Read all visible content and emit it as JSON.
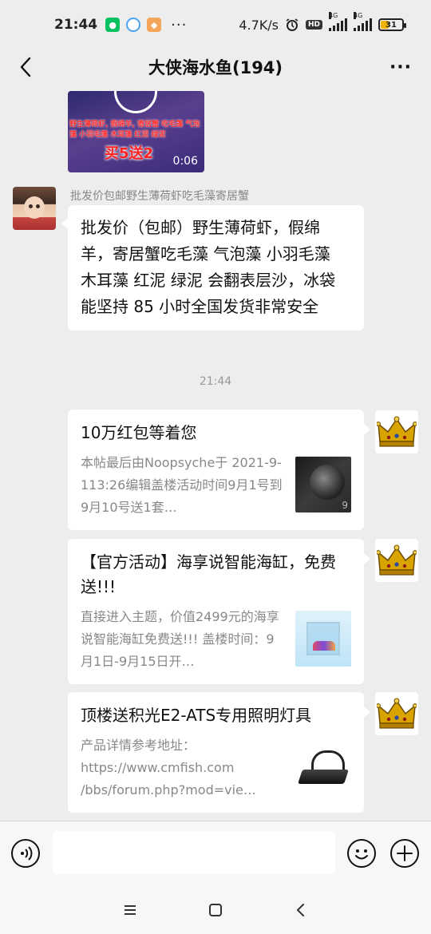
{
  "status_bar": {
    "time": "21:44",
    "speed": "4.7K/s",
    "hd": "HD",
    "net1": "4G",
    "net2": "4G",
    "battery": "31",
    "more": "···"
  },
  "header": {
    "title": "大侠海水鱼(194)",
    "more": "···"
  },
  "video": {
    "caption": "野生薄荷虾, 假绵羊, 寄居蟹 吃毛藻 气泡藻 小羽毛藻 木耳藻 红泥 绿泥",
    "promo": "买5送2",
    "duration": "0:06"
  },
  "message": {
    "sender": "批发价包邮野生薄荷虾吃毛藻寄居蟹",
    "text": "批发价（包邮）野生薄荷虾，假绵羊，寄居蟹吃毛藻 气泡藻 小羽毛藻 木耳藻 红泥 绿泥 会翻表层沙，冰袋能坚持 85 小时全国发货非常安全"
  },
  "time_separator": "21:44",
  "cards": [
    {
      "title": "10万红包等着您",
      "desc": "本帖最后由Noopsyche于 2021-9-113:26编辑盖楼活动时间9月1号到9月10号送1套…",
      "thumb_mark": "9"
    },
    {
      "title": "【官方活动】海享说智能海缸，免费送!!!",
      "desc": "直接进入主题，价值2499元的海享说智能海缸免费送!!! 盖楼时间：9月1日-9月15日开…"
    },
    {
      "title": "顶楼送积光E2-ATS专用照明灯具",
      "desc": "产品详情参考地址： https://www.cmfish.com /bbs/forum.php?mod=vie…"
    }
  ],
  "input": {
    "placeholder": ""
  },
  "colors": {
    "background": "#ededed",
    "bubble": "#ffffff",
    "crown_gold": "#d9a400",
    "wechat_green": "#07c160"
  },
  "icons": {
    "back": "chevron-left-icon",
    "more": "more-icon",
    "voice": "voice-icon",
    "emoji": "emoji-icon",
    "plus": "plus-icon",
    "menu": "menu-icon",
    "home": "home-icon",
    "sys_back": "back-icon"
  }
}
